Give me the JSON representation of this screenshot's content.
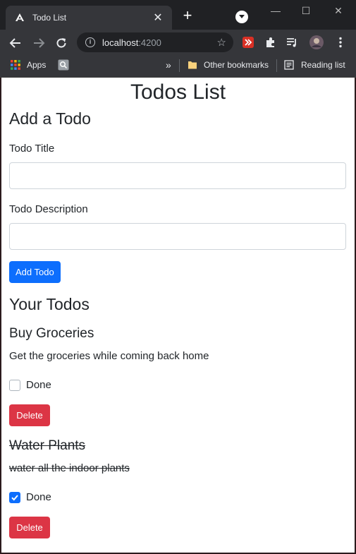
{
  "browser": {
    "tab_title": "Todo List",
    "url_host": "localhost",
    "url_port": ":4200",
    "bookmarks": {
      "apps_label": "Apps",
      "overflow_label": "»",
      "other_label": "Other bookmarks",
      "reading_label": "Reading list"
    }
  },
  "page": {
    "title": "Todos List",
    "add_heading": "Add a Todo",
    "title_label": "Todo Title",
    "title_value": "",
    "desc_label": "Todo Description",
    "desc_value": "",
    "add_button": "Add Todo",
    "list_heading": "Your Todos",
    "todos": [
      {
        "title": "Buy Groceries",
        "description": "Get the groceries while coming back home",
        "done": false,
        "done_label": "Done",
        "delete_label": "Delete"
      },
      {
        "title": "Water Plants",
        "description": "water all the indoor plants",
        "done": true,
        "done_label": "Done",
        "delete_label": "Delete"
      }
    ]
  },
  "colors": {
    "primary": "#0d6efd",
    "danger": "#dc3545",
    "chrome_dark": "#202124",
    "chrome_tab": "#35363a"
  }
}
